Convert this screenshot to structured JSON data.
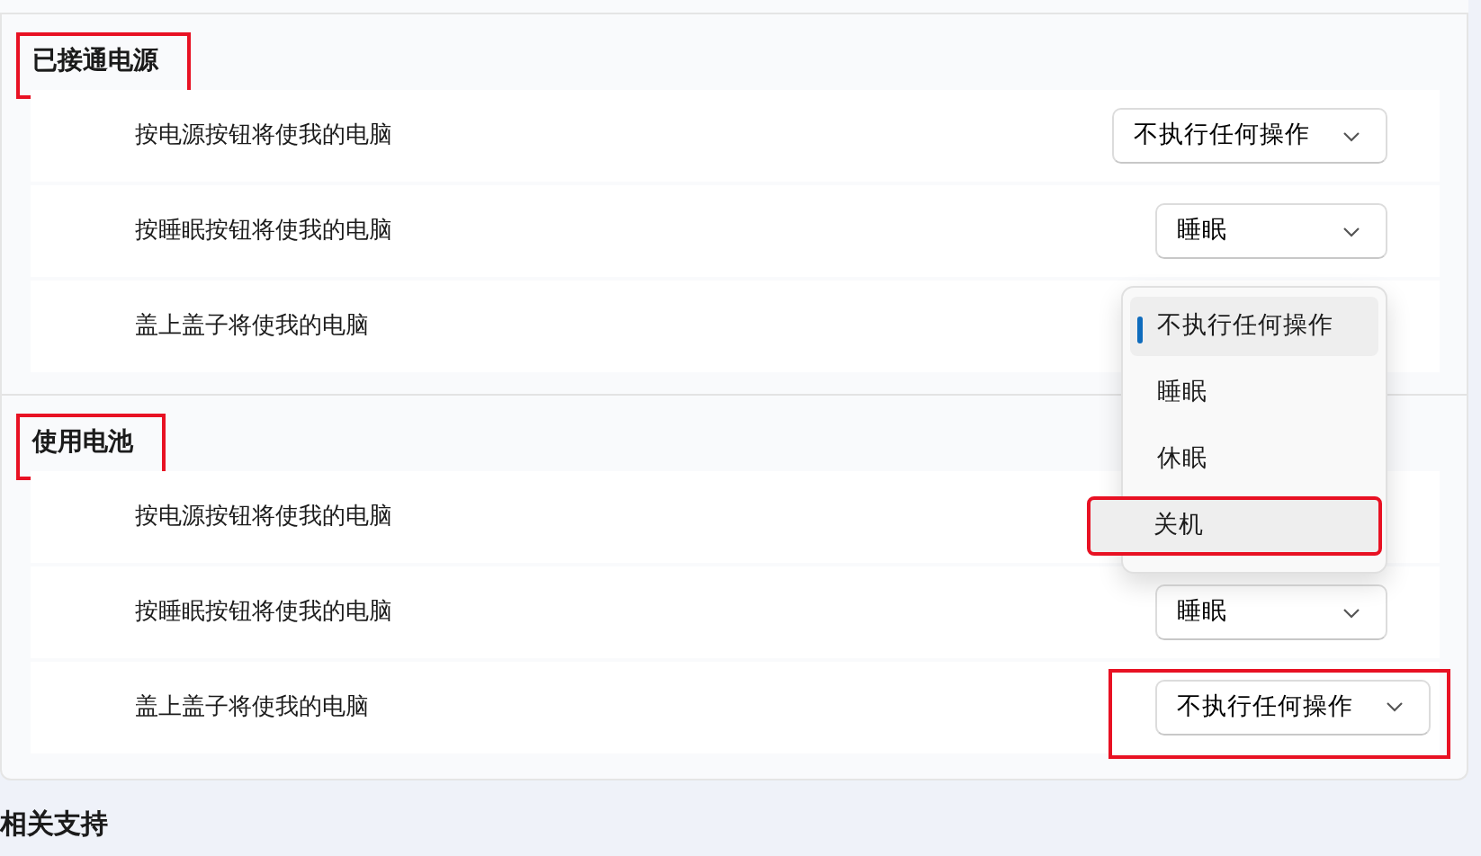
{
  "sections": [
    {
      "title": "已接通电源",
      "highlighted": true,
      "rows": [
        {
          "label": "按电源按钮将使我的电脑",
          "value": "不执行任何操作"
        },
        {
          "label": "按睡眠按钮将使我的电脑",
          "value": "睡眠"
        },
        {
          "label": "盖上盖子将使我的电脑",
          "menu": [
            {
              "label": "不执行任何操作",
              "selected": true,
              "highlighted": false
            },
            {
              "label": "睡眠",
              "selected": false,
              "highlighted": false
            },
            {
              "label": "休眠",
              "selected": false,
              "highlighted": false
            },
            {
              "label": "关机",
              "selected": false,
              "hovered": true,
              "highlighted": true
            }
          ]
        }
      ]
    },
    {
      "title": "使用电池",
      "highlighted": true,
      "rows": [
        {
          "label": "按电源按钮将使我的电脑"
        },
        {
          "label": "按睡眠按钮将使我的电脑",
          "value": "睡眠"
        },
        {
          "label": "盖上盖子将使我的电脑",
          "value": "不执行任何操作",
          "highlighted": true
        }
      ]
    }
  ],
  "footer_heading": "相关支持"
}
